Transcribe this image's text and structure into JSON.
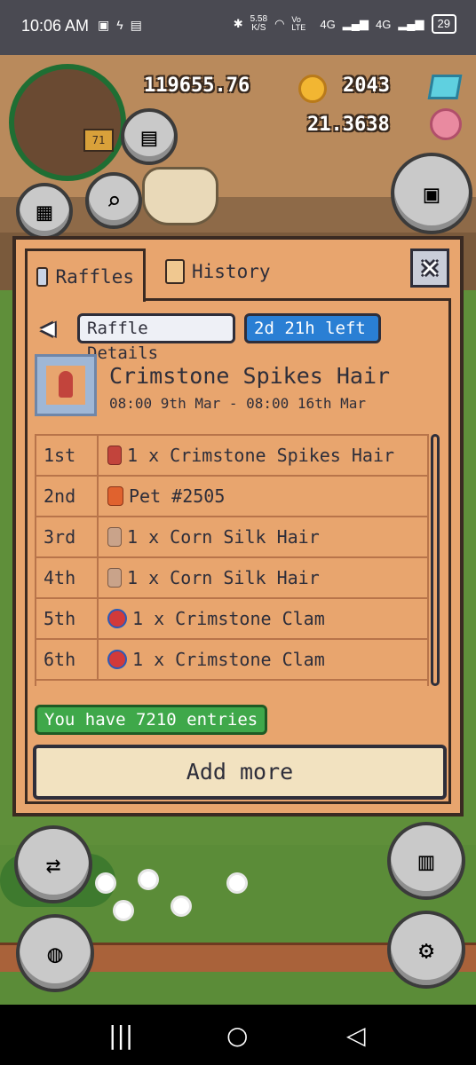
{
  "status_bar": {
    "time": "10:06 AM",
    "net_speed": "5.58",
    "net_unit": "K/S",
    "vo_lte": "Vo LTE",
    "sig1": "4G",
    "sig2": "4G",
    "battery": "29"
  },
  "hud": {
    "coins": "119655.76",
    "gems": "2043",
    "flower_balance": "21.3638",
    "level": "71"
  },
  "modal": {
    "tabs": [
      {
        "label": "Raffles"
      },
      {
        "label": "History"
      }
    ],
    "close_label": "✕",
    "details_label": "Raffle Details",
    "time_left": "2d 21h left",
    "prize_title": "Crimstone Spikes Hair",
    "prize_dates": "08:00 9th Mar - 08:00 16th Mar",
    "rows": [
      {
        "place": "1st",
        "prize": "1 x Crimstone Spikes Hair"
      },
      {
        "place": "2nd",
        "prize": "Pet #2505"
      },
      {
        "place": "3rd",
        "prize": "1 x Corn Silk Hair"
      },
      {
        "place": "4th",
        "prize": "1 x Corn Silk Hair"
      },
      {
        "place": "5th",
        "prize": "1 x Crimstone Clam"
      },
      {
        "place": "6th",
        "prize": "1 x Crimstone Clam"
      }
    ],
    "entries_text": "You have 7210 entries",
    "add_more": "Add more"
  },
  "nav": {
    "recents": "|||",
    "home": "○",
    "back": "◁"
  },
  "colors": {
    "panel": "#e8a56e",
    "time_pill": "#2a7fd4",
    "entries_badge": "#3fa84a"
  }
}
